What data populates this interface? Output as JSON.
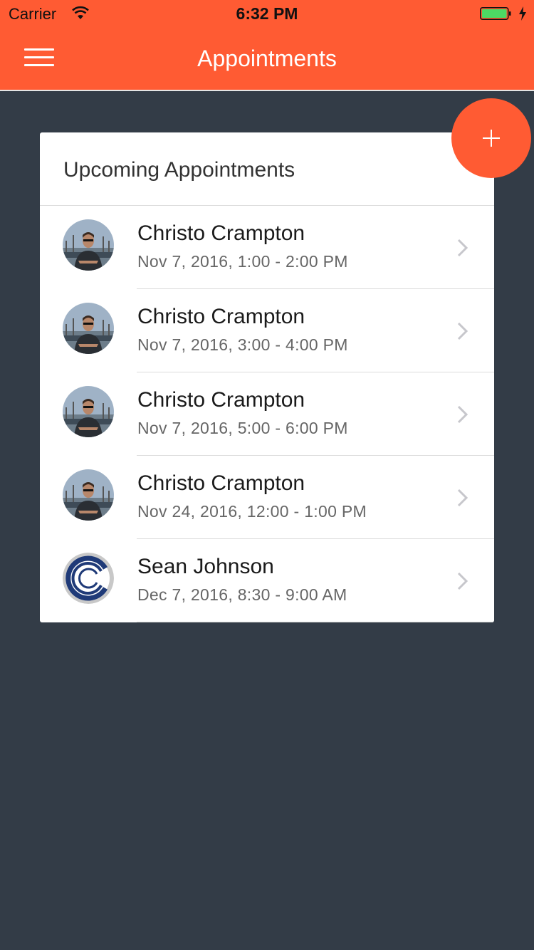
{
  "status_bar": {
    "carrier": "Carrier",
    "time": "6:32 PM"
  },
  "nav": {
    "title": "Appointments"
  },
  "card": {
    "title": "Upcoming Appointments",
    "appointments": [
      {
        "name": "Christo Crampton",
        "datetime": "Nov 7, 2016, 1:00 - 2:00 PM",
        "avatar": "person-photo"
      },
      {
        "name": "Christo Crampton",
        "datetime": "Nov 7, 2016, 3:00 - 4:00 PM",
        "avatar": "person-photo"
      },
      {
        "name": "Christo Crampton",
        "datetime": "Nov 7, 2016, 5:00 - 6:00 PM",
        "avatar": "person-photo"
      },
      {
        "name": "Christo Crampton",
        "datetime": "Nov 24, 2016, 12:00 - 1:00 PM",
        "avatar": "person-photo"
      },
      {
        "name": "Sean Johnson",
        "datetime": "Dec 7, 2016, 8:30 - 9:00 AM",
        "avatar": "logo-c"
      }
    ]
  },
  "icons": {
    "menu": "hamburger-menu-icon",
    "add": "plus-icon",
    "row": "chevron-right-icon",
    "wifi": "wifi-icon",
    "battery": "battery-icon"
  },
  "colors": {
    "accent": "#ff5b33",
    "background": "#333c47",
    "card": "#ffffff",
    "battery": "#4cd964"
  }
}
